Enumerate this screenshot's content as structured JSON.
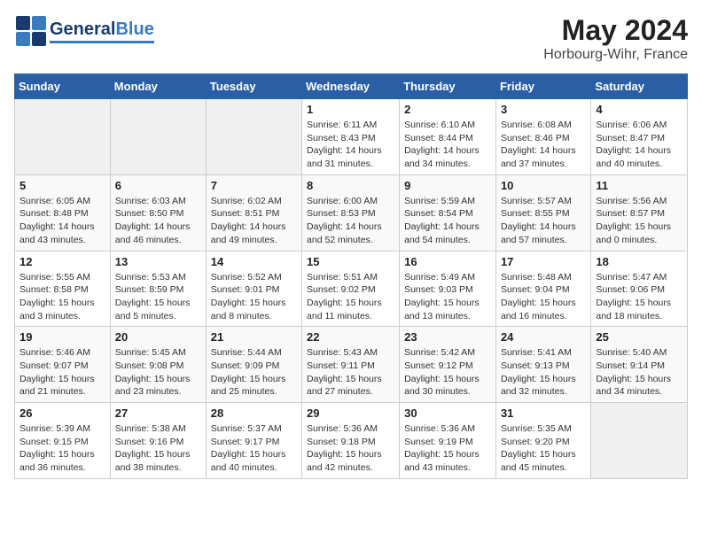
{
  "logo": {
    "general": "General",
    "blue": "Blue"
  },
  "title": {
    "month_year": "May 2024",
    "location": "Horbourg-Wihr, France"
  },
  "days_of_week": [
    "Sunday",
    "Monday",
    "Tuesday",
    "Wednesday",
    "Thursday",
    "Friday",
    "Saturday"
  ],
  "weeks": [
    [
      {
        "day": "",
        "info": ""
      },
      {
        "day": "",
        "info": ""
      },
      {
        "day": "",
        "info": ""
      },
      {
        "day": "1",
        "info": "Sunrise: 6:11 AM\nSunset: 8:43 PM\nDaylight: 14 hours\nand 31 minutes."
      },
      {
        "day": "2",
        "info": "Sunrise: 6:10 AM\nSunset: 8:44 PM\nDaylight: 14 hours\nand 34 minutes."
      },
      {
        "day": "3",
        "info": "Sunrise: 6:08 AM\nSunset: 8:46 PM\nDaylight: 14 hours\nand 37 minutes."
      },
      {
        "day": "4",
        "info": "Sunrise: 6:06 AM\nSunset: 8:47 PM\nDaylight: 14 hours\nand 40 minutes."
      }
    ],
    [
      {
        "day": "5",
        "info": "Sunrise: 6:05 AM\nSunset: 8:48 PM\nDaylight: 14 hours\nand 43 minutes."
      },
      {
        "day": "6",
        "info": "Sunrise: 6:03 AM\nSunset: 8:50 PM\nDaylight: 14 hours\nand 46 minutes."
      },
      {
        "day": "7",
        "info": "Sunrise: 6:02 AM\nSunset: 8:51 PM\nDaylight: 14 hours\nand 49 minutes."
      },
      {
        "day": "8",
        "info": "Sunrise: 6:00 AM\nSunset: 8:53 PM\nDaylight: 14 hours\nand 52 minutes."
      },
      {
        "day": "9",
        "info": "Sunrise: 5:59 AM\nSunset: 8:54 PM\nDaylight: 14 hours\nand 54 minutes."
      },
      {
        "day": "10",
        "info": "Sunrise: 5:57 AM\nSunset: 8:55 PM\nDaylight: 14 hours\nand 57 minutes."
      },
      {
        "day": "11",
        "info": "Sunrise: 5:56 AM\nSunset: 8:57 PM\nDaylight: 15 hours\nand 0 minutes."
      }
    ],
    [
      {
        "day": "12",
        "info": "Sunrise: 5:55 AM\nSunset: 8:58 PM\nDaylight: 15 hours\nand 3 minutes."
      },
      {
        "day": "13",
        "info": "Sunrise: 5:53 AM\nSunset: 8:59 PM\nDaylight: 15 hours\nand 5 minutes."
      },
      {
        "day": "14",
        "info": "Sunrise: 5:52 AM\nSunset: 9:01 PM\nDaylight: 15 hours\nand 8 minutes."
      },
      {
        "day": "15",
        "info": "Sunrise: 5:51 AM\nSunset: 9:02 PM\nDaylight: 15 hours\nand 11 minutes."
      },
      {
        "day": "16",
        "info": "Sunrise: 5:49 AM\nSunset: 9:03 PM\nDaylight: 15 hours\nand 13 minutes."
      },
      {
        "day": "17",
        "info": "Sunrise: 5:48 AM\nSunset: 9:04 PM\nDaylight: 15 hours\nand 16 minutes."
      },
      {
        "day": "18",
        "info": "Sunrise: 5:47 AM\nSunset: 9:06 PM\nDaylight: 15 hours\nand 18 minutes."
      }
    ],
    [
      {
        "day": "19",
        "info": "Sunrise: 5:46 AM\nSunset: 9:07 PM\nDaylight: 15 hours\nand 21 minutes."
      },
      {
        "day": "20",
        "info": "Sunrise: 5:45 AM\nSunset: 9:08 PM\nDaylight: 15 hours\nand 23 minutes."
      },
      {
        "day": "21",
        "info": "Sunrise: 5:44 AM\nSunset: 9:09 PM\nDaylight: 15 hours\nand 25 minutes."
      },
      {
        "day": "22",
        "info": "Sunrise: 5:43 AM\nSunset: 9:11 PM\nDaylight: 15 hours\nand 27 minutes."
      },
      {
        "day": "23",
        "info": "Sunrise: 5:42 AM\nSunset: 9:12 PM\nDaylight: 15 hours\nand 30 minutes."
      },
      {
        "day": "24",
        "info": "Sunrise: 5:41 AM\nSunset: 9:13 PM\nDaylight: 15 hours\nand 32 minutes."
      },
      {
        "day": "25",
        "info": "Sunrise: 5:40 AM\nSunset: 9:14 PM\nDaylight: 15 hours\nand 34 minutes."
      }
    ],
    [
      {
        "day": "26",
        "info": "Sunrise: 5:39 AM\nSunset: 9:15 PM\nDaylight: 15 hours\nand 36 minutes."
      },
      {
        "day": "27",
        "info": "Sunrise: 5:38 AM\nSunset: 9:16 PM\nDaylight: 15 hours\nand 38 minutes."
      },
      {
        "day": "28",
        "info": "Sunrise: 5:37 AM\nSunset: 9:17 PM\nDaylight: 15 hours\nand 40 minutes."
      },
      {
        "day": "29",
        "info": "Sunrise: 5:36 AM\nSunset: 9:18 PM\nDaylight: 15 hours\nand 42 minutes."
      },
      {
        "day": "30",
        "info": "Sunrise: 5:36 AM\nSunset: 9:19 PM\nDaylight: 15 hours\nand 43 minutes."
      },
      {
        "day": "31",
        "info": "Sunrise: 5:35 AM\nSunset: 9:20 PM\nDaylight: 15 hours\nand 45 minutes."
      },
      {
        "day": "",
        "info": ""
      }
    ]
  ]
}
